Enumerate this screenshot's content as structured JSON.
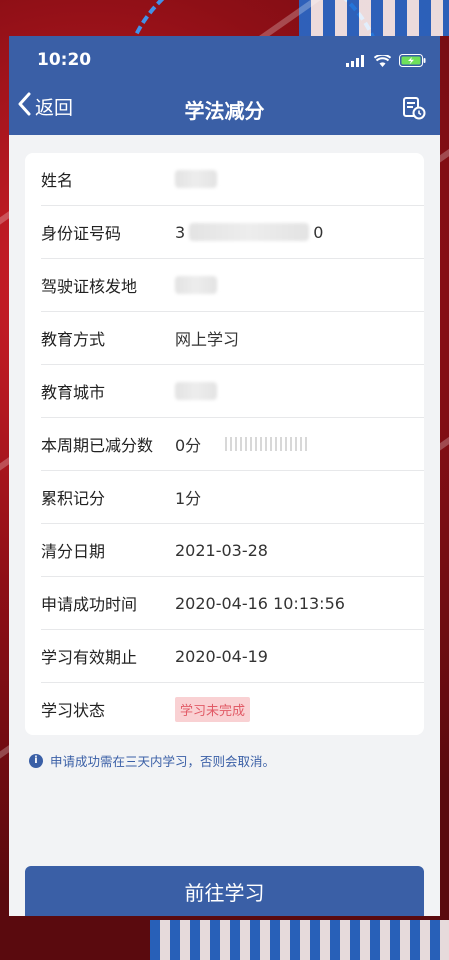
{
  "status_bar": {
    "time": "10:20"
  },
  "nav": {
    "back_label": "返回",
    "title": "学法减分"
  },
  "info_rows": [
    {
      "label": "姓名",
      "value": ""
    },
    {
      "label": "身份证号码",
      "value_prefix": "3",
      "value_suffix": "0"
    },
    {
      "label": "驾驶证核发地",
      "value": ""
    },
    {
      "label": "教育方式",
      "value": "网上学习"
    },
    {
      "label": "教育城市",
      "value": ""
    },
    {
      "label": "本周期已减分数",
      "value": "0分"
    },
    {
      "label": "累积记分",
      "value": "1分"
    },
    {
      "label": "清分日期",
      "value": "2021-03-28"
    },
    {
      "label": "申请成功时间",
      "value": "2020-04-16 10:13:56"
    },
    {
      "label": "学习有效期止",
      "value": "2020-04-19"
    },
    {
      "label": "学习状态",
      "value": "学习未完成"
    }
  ],
  "notice": {
    "icon": "info-icon",
    "text": "申请成功需在三天内学习，否则会取消。"
  },
  "action": {
    "label": "前往学习"
  },
  "colors": {
    "primary": "#3a5fa6",
    "badge_bg": "#f9d1d3",
    "badge_text": "#e15a66"
  }
}
